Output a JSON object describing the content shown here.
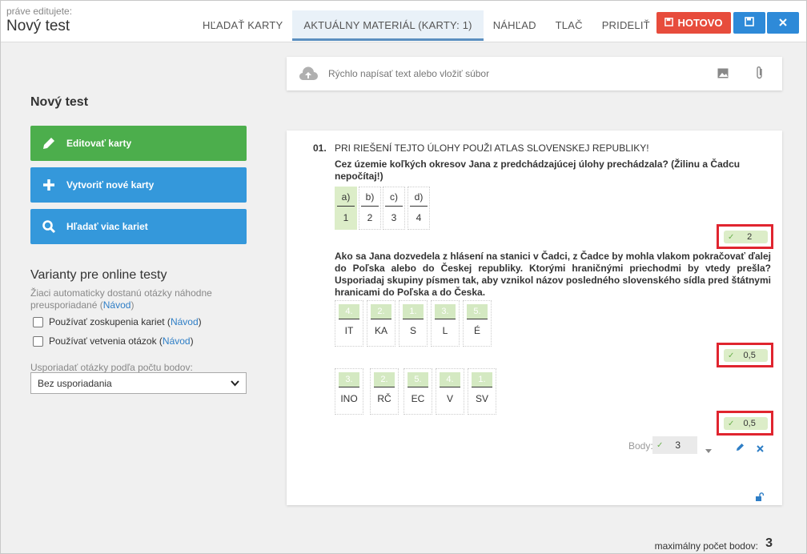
{
  "header": {
    "editing_label": "práve editujete:",
    "doc_title": "Nový test",
    "tabs": [
      {
        "label": "HĽADAŤ KARTY"
      },
      {
        "label": "AKTUÁLNY MATERIÁL (KARTY: 1)"
      },
      {
        "label": "NÁHĽAD"
      },
      {
        "label": "TLAČ"
      },
      {
        "label": "PRIDELIŤ"
      }
    ],
    "active_tab_index": 1,
    "done_label": "HOTOVO"
  },
  "left": {
    "title": "Nový test",
    "buttons": [
      {
        "label": "Editovať karty",
        "icon": "pencil-icon",
        "color": "#4cae4c"
      },
      {
        "label": "Vytvoriť nové karty",
        "icon": "plus-icon",
        "color": "#3498db"
      },
      {
        "label": "Hľadať viac kariet",
        "icon": "search-icon",
        "color": "#3498db"
      }
    ],
    "variants_title": "Varianty pre online testy",
    "variants_desc": "Žiaci automaticky dostanú otázky náhodne preusporiadané",
    "guide_link": "Návod",
    "checkbox1": "Používať zoskupenia kariet",
    "checkbox2": "Používať vetvenia otázok",
    "sort_label": "Usporiadať otázky podľa počtu bodov:",
    "sort_value": "Bez usporiadania"
  },
  "quick_input": {
    "placeholder": "Rýchlo napísať text alebo vložiť súbor"
  },
  "card": {
    "number": "01.",
    "heading": "PRI RIEŠENÍ TEJTO ÚLOHY POUŽI ATLAS SLOVENSKEJ REPUBLIKY!",
    "q1_text": "Cez územie koľkých okresov Jana z predchádzajúcej úlohy prechádzala? (Žilinu a Čadcu nepočítaj!)",
    "q1_options": [
      {
        "top": "a)",
        "bottom": "1",
        "selected": true
      },
      {
        "top": "b)",
        "bottom": "2",
        "selected": false
      },
      {
        "top": "c)",
        "bottom": "3",
        "selected": false
      },
      {
        "top": "d)",
        "bottom": "4",
        "selected": false
      }
    ],
    "score1": "2",
    "q2_text": "Ako sa Jana dozvedela z hlásení na stanici v Čadci, z Čadce by mohla vlakom pokračovať ďalej do Poľska alebo do Českej republiky. Ktorými hraničnými priechodmi by vtedy prešla? Usporiadaj skupiny písmen tak, aby vznikol názov posledného slovenského sídla pred štátnymi hranicami do Poľska a do Česka.",
    "row1": [
      {
        "top": "4.",
        "bottom": "IT"
      },
      {
        "top": "2.",
        "bottom": "KA"
      },
      {
        "top": "1.",
        "bottom": "S"
      },
      {
        "top": "3.",
        "bottom": "L"
      },
      {
        "top": "5.",
        "bottom": "É"
      }
    ],
    "score2": "0,5",
    "row2": [
      {
        "top": "3.",
        "bottom": "INO"
      },
      {
        "top": "2.",
        "bottom": "RČ"
      },
      {
        "top": "5.",
        "bottom": "EC"
      },
      {
        "top": "4.",
        "bottom": "V"
      },
      {
        "top": "1.",
        "bottom": "SV"
      }
    ],
    "score3": "0,5",
    "points_label": "Body:",
    "points_value": "3"
  },
  "footer": {
    "max_label": "maximálny počet bodov:",
    "max_value": "3"
  },
  "colors": {
    "accent_blue": "#2e8ad8",
    "danger_red": "#e74c3c",
    "highlight_red": "#e0252f",
    "correct_green": "#dcedc8"
  }
}
